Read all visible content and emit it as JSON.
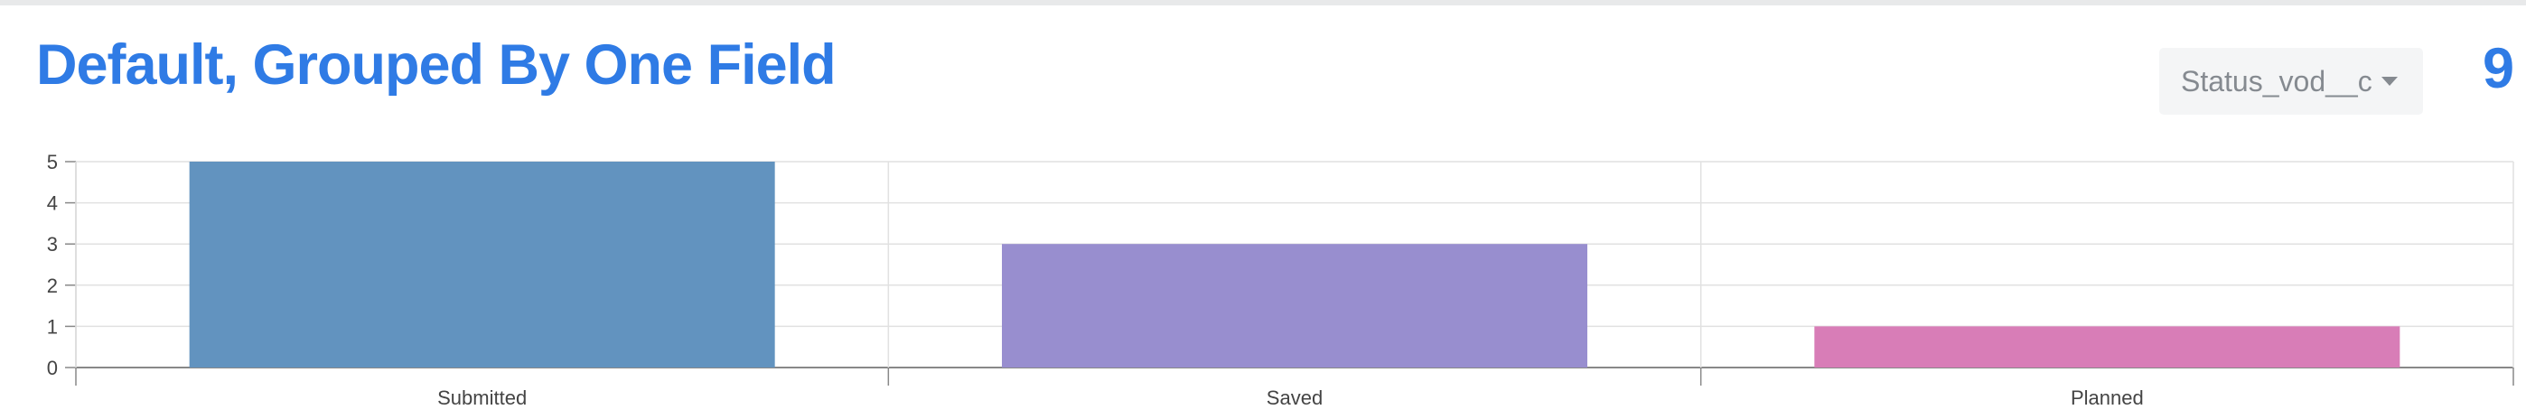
{
  "header": {
    "title": "Default, Grouped By One Field",
    "group_field": "Status_vod__c",
    "total": "9"
  },
  "colors": {
    "accent": "#2f7be5",
    "bar_submitted": "#6293bf",
    "bar_saved": "#988ecf",
    "bar_planned": "#d87db7"
  },
  "chart_data": {
    "type": "bar",
    "categories": [
      "Submitted",
      "Saved",
      "Planned"
    ],
    "values": [
      5,
      3,
      1
    ],
    "bar_colors": [
      "#6293bf",
      "#988ecf",
      "#d87db7"
    ],
    "ylim": [
      0,
      5
    ],
    "yticks": [
      "0",
      "1",
      "2",
      "3",
      "4",
      "5"
    ],
    "grid": true,
    "legend": "none",
    "title": "",
    "xlabel": "",
    "ylabel": ""
  }
}
